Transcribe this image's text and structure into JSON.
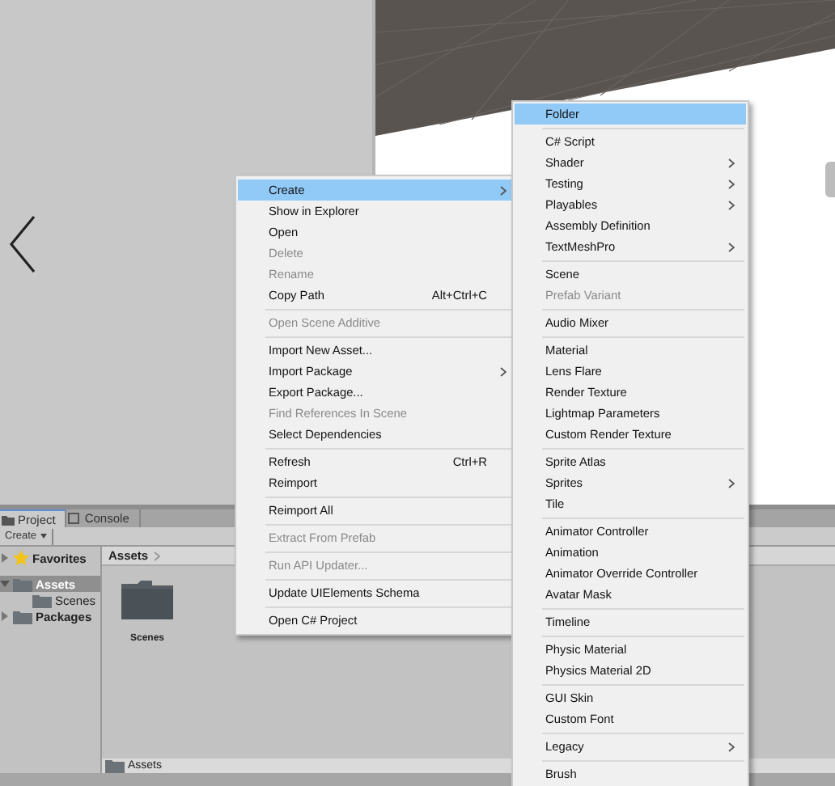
{
  "context_menu": {
    "items": [
      {
        "kind": "item",
        "label": "Create",
        "selected": true,
        "disabled": false,
        "submenu": true
      },
      {
        "kind": "item",
        "label": "Show in Explorer",
        "selected": false,
        "disabled": false,
        "submenu": false
      },
      {
        "kind": "item",
        "label": "Open",
        "selected": false,
        "disabled": false,
        "submenu": false
      },
      {
        "kind": "item",
        "label": "Delete",
        "selected": false,
        "disabled": true,
        "submenu": false
      },
      {
        "kind": "item",
        "label": "Rename",
        "selected": false,
        "disabled": true,
        "submenu": false
      },
      {
        "kind": "item",
        "label": "Copy Path",
        "selected": false,
        "disabled": false,
        "submenu": false,
        "shortcut": "Alt+Ctrl+C"
      },
      {
        "kind": "separator"
      },
      {
        "kind": "item",
        "label": "Open Scene Additive",
        "selected": false,
        "disabled": true,
        "submenu": false
      },
      {
        "kind": "separator"
      },
      {
        "kind": "item",
        "label": "Import New Asset...",
        "selected": false,
        "disabled": false,
        "submenu": false
      },
      {
        "kind": "item",
        "label": "Import Package",
        "selected": false,
        "disabled": false,
        "submenu": true
      },
      {
        "kind": "item",
        "label": "Export Package...",
        "selected": false,
        "disabled": false,
        "submenu": false
      },
      {
        "kind": "item",
        "label": "Find References In Scene",
        "selected": false,
        "disabled": true,
        "submenu": false
      },
      {
        "kind": "item",
        "label": "Select Dependencies",
        "selected": false,
        "disabled": false,
        "submenu": false
      },
      {
        "kind": "separator"
      },
      {
        "kind": "item",
        "label": "Refresh",
        "selected": false,
        "disabled": false,
        "submenu": false,
        "shortcut": "Ctrl+R"
      },
      {
        "kind": "item",
        "label": "Reimport",
        "selected": false,
        "disabled": false,
        "submenu": false
      },
      {
        "kind": "separator"
      },
      {
        "kind": "item",
        "label": "Reimport All",
        "selected": false,
        "disabled": false,
        "submenu": false
      },
      {
        "kind": "separator"
      },
      {
        "kind": "item",
        "label": "Extract From Prefab",
        "selected": false,
        "disabled": true,
        "submenu": false
      },
      {
        "kind": "separator"
      },
      {
        "kind": "item",
        "label": "Run API Updater...",
        "selected": false,
        "disabled": true,
        "submenu": false
      },
      {
        "kind": "separator"
      },
      {
        "kind": "item",
        "label": "Update UIElements Schema",
        "selected": false,
        "disabled": false,
        "submenu": false
      },
      {
        "kind": "separator"
      },
      {
        "kind": "item",
        "label": "Open C# Project",
        "selected": false,
        "disabled": false,
        "submenu": false
      }
    ]
  },
  "create_submenu": {
    "items": [
      {
        "kind": "item",
        "label": "Folder",
        "selected": true,
        "disabled": false,
        "submenu": false
      },
      {
        "kind": "separator"
      },
      {
        "kind": "item",
        "label": "C# Script",
        "selected": false,
        "disabled": false,
        "submenu": false
      },
      {
        "kind": "item",
        "label": "Shader",
        "selected": false,
        "disabled": false,
        "submenu": true
      },
      {
        "kind": "item",
        "label": "Testing",
        "selected": false,
        "disabled": false,
        "submenu": true
      },
      {
        "kind": "item",
        "label": "Playables",
        "selected": false,
        "disabled": false,
        "submenu": true
      },
      {
        "kind": "item",
        "label": "Assembly Definition",
        "selected": false,
        "disabled": false,
        "submenu": false
      },
      {
        "kind": "item",
        "label": "TextMeshPro",
        "selected": false,
        "disabled": false,
        "submenu": true
      },
      {
        "kind": "separator"
      },
      {
        "kind": "item",
        "label": "Scene",
        "selected": false,
        "disabled": false,
        "submenu": false
      },
      {
        "kind": "item",
        "label": "Prefab Variant",
        "selected": false,
        "disabled": true,
        "submenu": false
      },
      {
        "kind": "separator"
      },
      {
        "kind": "item",
        "label": "Audio Mixer",
        "selected": false,
        "disabled": false,
        "submenu": false
      },
      {
        "kind": "separator"
      },
      {
        "kind": "item",
        "label": "Material",
        "selected": false,
        "disabled": false,
        "submenu": false
      },
      {
        "kind": "item",
        "label": "Lens Flare",
        "selected": false,
        "disabled": false,
        "submenu": false
      },
      {
        "kind": "item",
        "label": "Render Texture",
        "selected": false,
        "disabled": false,
        "submenu": false
      },
      {
        "kind": "item",
        "label": "Lightmap Parameters",
        "selected": false,
        "disabled": false,
        "submenu": false
      },
      {
        "kind": "item",
        "label": "Custom Render Texture",
        "selected": false,
        "disabled": false,
        "submenu": false
      },
      {
        "kind": "separator"
      },
      {
        "kind": "item",
        "label": "Sprite Atlas",
        "selected": false,
        "disabled": false,
        "submenu": false
      },
      {
        "kind": "item",
        "label": "Sprites",
        "selected": false,
        "disabled": false,
        "submenu": true
      },
      {
        "kind": "item",
        "label": "Tile",
        "selected": false,
        "disabled": false,
        "submenu": false
      },
      {
        "kind": "separator"
      },
      {
        "kind": "item",
        "label": "Animator Controller",
        "selected": false,
        "disabled": false,
        "submenu": false
      },
      {
        "kind": "item",
        "label": "Animation",
        "selected": false,
        "disabled": false,
        "submenu": false
      },
      {
        "kind": "item",
        "label": "Animator Override Controller",
        "selected": false,
        "disabled": false,
        "submenu": false
      },
      {
        "kind": "item",
        "label": "Avatar Mask",
        "selected": false,
        "disabled": false,
        "submenu": false
      },
      {
        "kind": "separator"
      },
      {
        "kind": "item",
        "label": "Timeline",
        "selected": false,
        "disabled": false,
        "submenu": false
      },
      {
        "kind": "separator"
      },
      {
        "kind": "item",
        "label": "Physic Material",
        "selected": false,
        "disabled": false,
        "submenu": false
      },
      {
        "kind": "item",
        "label": "Physics Material 2D",
        "selected": false,
        "disabled": false,
        "submenu": false
      },
      {
        "kind": "separator"
      },
      {
        "kind": "item",
        "label": "GUI Skin",
        "selected": false,
        "disabled": false,
        "submenu": false
      },
      {
        "kind": "item",
        "label": "Custom Font",
        "selected": false,
        "disabled": false,
        "submenu": false
      },
      {
        "kind": "separator"
      },
      {
        "kind": "item",
        "label": "Legacy",
        "selected": false,
        "disabled": false,
        "submenu": true
      },
      {
        "kind": "separator"
      },
      {
        "kind": "item",
        "label": "Brush",
        "selected": false,
        "disabled": false,
        "submenu": false
      }
    ]
  },
  "project_panel": {
    "tabs": [
      {
        "label": "Project",
        "selected": true
      },
      {
        "label": "Console",
        "selected": false
      }
    ],
    "create_button": "Create",
    "tree": [
      {
        "label": "Favorites",
        "kind": "favorites",
        "expanded": false,
        "selected": false
      },
      {
        "label": "Assets",
        "kind": "folder",
        "expanded": true,
        "selected": true,
        "children": [
          {
            "label": "Scenes",
            "kind": "folder",
            "selected": false
          }
        ]
      },
      {
        "label": "Packages",
        "kind": "folder",
        "expanded": false,
        "selected": false
      }
    ],
    "breadcrumb": "Assets",
    "assets": [
      {
        "label": "Scenes",
        "kind": "folder"
      }
    ],
    "path_bar": "Assets"
  }
}
